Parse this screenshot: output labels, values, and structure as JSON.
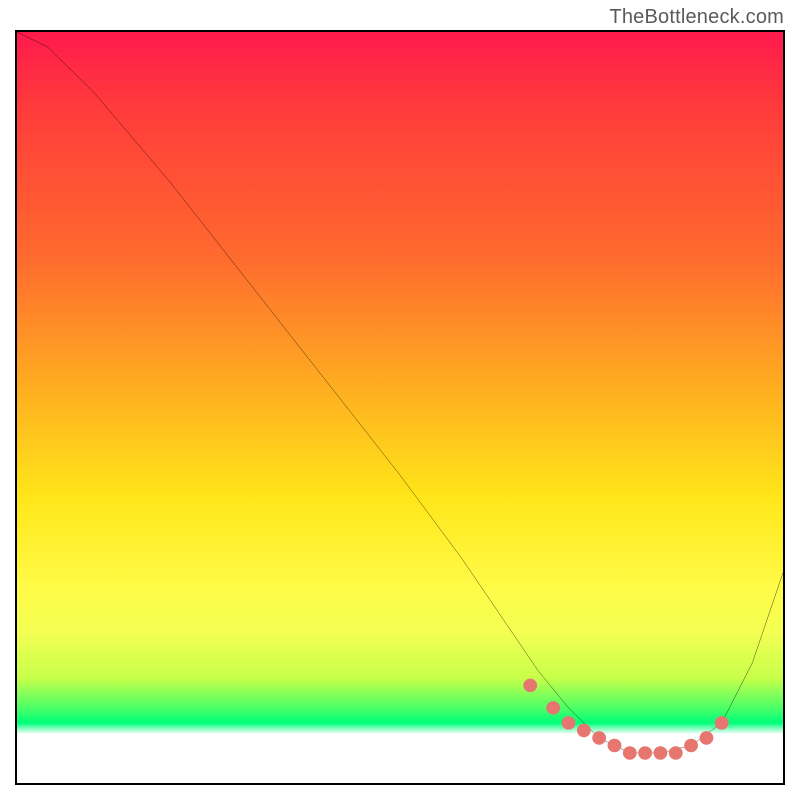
{
  "watermark": "TheBottleneck.com",
  "chart_data": {
    "type": "line",
    "title": "",
    "xlabel": "",
    "ylabel": "",
    "xlim": [
      0,
      100
    ],
    "ylim": [
      0,
      100
    ],
    "grid": false,
    "legend": false,
    "series": [
      {
        "name": "bottleneck-curve",
        "x": [
          0,
          4,
          10,
          20,
          30,
          40,
          50,
          58,
          64,
          68,
          72,
          76,
          80,
          84,
          88,
          92,
          96,
          100
        ],
        "y": [
          100,
          98,
          92,
          80,
          67,
          54,
          41,
          30,
          21,
          15,
          10,
          6,
          4,
          4,
          5,
          8,
          16,
          28
        ]
      },
      {
        "name": "optimal-markers",
        "x": [
          67,
          70,
          72,
          74,
          76,
          78,
          80,
          82,
          84,
          86,
          88,
          90,
          92
        ],
        "y": [
          13,
          10,
          8,
          7,
          6,
          5,
          4,
          4,
          4,
          4,
          5,
          6,
          8
        ]
      }
    ],
    "colors": {
      "curve": "#000000",
      "marker": "#e77670",
      "gradient_top": "#ff1a4d",
      "gradient_mid": "#ffe619",
      "gradient_band": "#00ff7a",
      "gradient_bottom": "#ffffff"
    }
  }
}
